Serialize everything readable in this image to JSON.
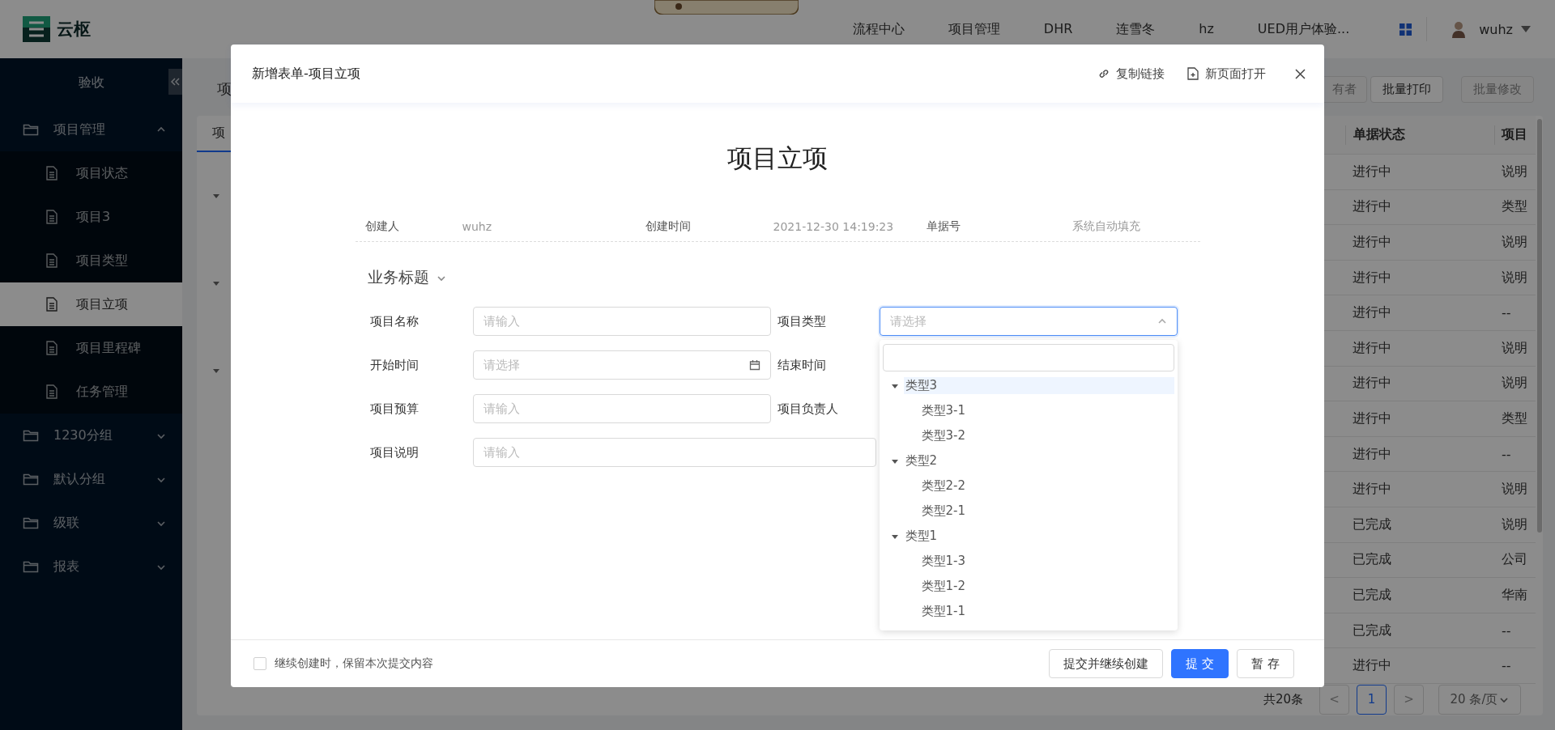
{
  "header": {
    "logo_text": "云枢",
    "nav": [
      {
        "label": "流程中心"
      },
      {
        "label": "项目管理"
      },
      {
        "label": "DHR"
      },
      {
        "label": "连雪冬"
      },
      {
        "label": "hz"
      },
      {
        "label": "UED用户体验..."
      }
    ],
    "user": {
      "name": "wuhz"
    }
  },
  "sidebar": {
    "title": "验收",
    "items": [
      {
        "label": "项目管理",
        "expanded": true,
        "children": [
          {
            "label": "项目状态",
            "selected": false
          },
          {
            "label": "项目3",
            "selected": false
          },
          {
            "label": "项目类型",
            "selected": false
          },
          {
            "label": "项目立项",
            "selected": true
          },
          {
            "label": "项目里程碑",
            "selected": false
          },
          {
            "label": "任务管理",
            "selected": false
          }
        ]
      },
      {
        "label": "1230分组",
        "expanded": false
      },
      {
        "label": "默认分组",
        "expanded": false
      },
      {
        "label": "级联",
        "expanded": false
      },
      {
        "label": "报表",
        "expanded": false
      }
    ]
  },
  "page": {
    "title": "项",
    "buttons": [
      {
        "label": "有者",
        "disabled": true
      },
      {
        "label": "批量打印",
        "disabled": false
      },
      {
        "label": "批量修改",
        "disabled": true
      }
    ],
    "tab": {
      "label": "项",
      "selected": true
    },
    "tree_nodes": [
      {
        "expanded": true
      },
      {
        "expanded": true
      },
      {
        "expanded": true
      }
    ],
    "table": {
      "columns": [
        "单据状态",
        "项目"
      ],
      "rows": [
        [
          "进行中",
          "说明"
        ],
        [
          "进行中",
          "类型"
        ],
        [
          "进行中",
          "说明"
        ],
        [
          "进行中",
          "说明"
        ],
        [
          "进行中",
          "--"
        ],
        [
          "进行中",
          "说明"
        ],
        [
          "进行中",
          "说明"
        ],
        [
          "进行中",
          "类型"
        ],
        [
          "进行中",
          "--"
        ],
        [
          "进行中",
          "说明"
        ],
        [
          "已完成",
          "说明"
        ],
        [
          "已完成",
          "公司"
        ],
        [
          "已完成",
          "华南"
        ],
        [
          "已完成",
          "--"
        ],
        [
          "进行中",
          "--"
        ]
      ]
    },
    "pagination": {
      "total": "共20条",
      "prev": "<",
      "pages": [
        {
          "label": "1",
          "selected": true
        }
      ],
      "next": ">",
      "page_size": "20 条/页"
    }
  },
  "modal": {
    "title": "新增表单-项目立项",
    "actions": [
      {
        "kind": "link",
        "label": "复制链接"
      },
      {
        "kind": "open",
        "label": "新页面打开"
      }
    ],
    "form_title": "项目立项",
    "meta": [
      {
        "label": "创建人",
        "value": "wuhz"
      },
      {
        "label": "创建时间",
        "value": "2021-12-30 14:19:23"
      },
      {
        "label": "单据号",
        "value": "系统自动填充"
      }
    ],
    "section": {
      "title": "业务标题",
      "expanded": true
    },
    "fields": [
      {
        "label": "项目名称",
        "kind": "text",
        "placeholder": "请输入"
      },
      {
        "label": "项目类型",
        "kind": "select",
        "placeholder": "请选择",
        "open": true
      },
      {
        "label": "开始时间",
        "kind": "date",
        "placeholder": "请选择"
      },
      {
        "label": "结束时间",
        "kind": "covered"
      },
      {
        "label": "项目预算",
        "kind": "text",
        "placeholder": "请输入"
      },
      {
        "label": "项目负责人",
        "kind": "covered"
      },
      {
        "label": "项目说明",
        "kind": "text",
        "placeholder": "请输入",
        "wide": true
      }
    ],
    "dropdown": {
      "options": [
        {
          "label": "类型3",
          "expanded": true,
          "selected": true,
          "children": [
            {
              "label": "类型3-1",
              "selected": false
            },
            {
              "label": "类型3-2",
              "selected": false
            }
          ]
        },
        {
          "label": "类型2",
          "expanded": true,
          "selected": false,
          "children": [
            {
              "label": "类型2-2",
              "selected": false
            },
            {
              "label": "类型2-1",
              "selected": false
            }
          ]
        },
        {
          "label": "类型1",
          "expanded": true,
          "selected": false,
          "children": [
            {
              "label": "类型1-3",
              "selected": false
            },
            {
              "label": "类型1-2",
              "selected": false
            },
            {
              "label": "类型1-1",
              "selected": false
            }
          ]
        }
      ]
    },
    "footer": {
      "checkbox": {
        "label": "继续创建时，保留本次提交内容",
        "checked": false
      },
      "buttons": [
        {
          "label": "提交并继续创建",
          "kind": "default"
        },
        {
          "label": "提 交",
          "kind": "primary"
        },
        {
          "label": "暂 存",
          "kind": "default"
        }
      ]
    }
  }
}
